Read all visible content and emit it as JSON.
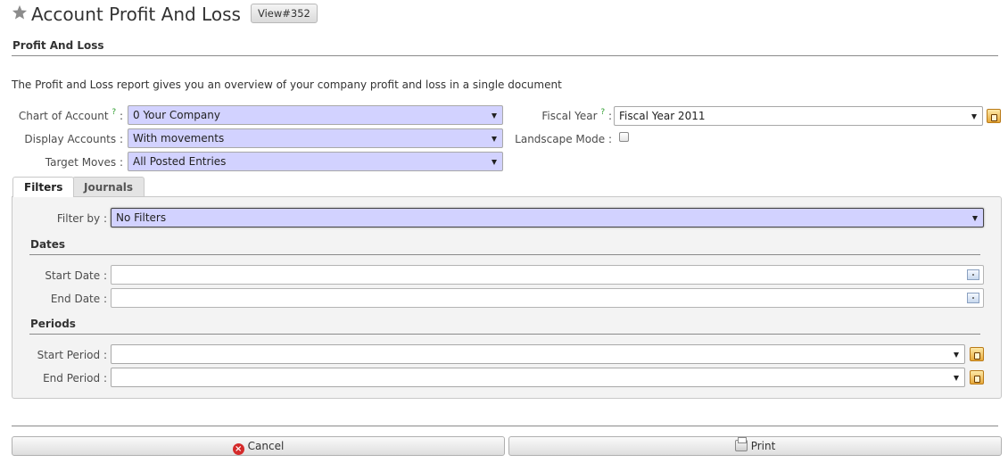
{
  "header": {
    "title": "Account Profit And Loss",
    "view_button": "View#352"
  },
  "section": {
    "title": "Profit And Loss",
    "description": "The Profit and Loss report gives you an overview of your company profit and loss in a single document"
  },
  "form": {
    "chart_of_account": {
      "label": "Chart of Account",
      "help": "?",
      "value": "0 Your Company"
    },
    "fiscal_year": {
      "label": "Fiscal Year",
      "help": "?",
      "value": "Fiscal Year 2011"
    },
    "display_accounts": {
      "label": "Display Accounts",
      "value": "With movements"
    },
    "landscape_mode": {
      "label": "Landscape Mode",
      "checked": false
    },
    "target_moves": {
      "label": "Target Moves",
      "value": "All Posted Entries"
    }
  },
  "tabs": [
    {
      "label": "Filters",
      "active": true
    },
    {
      "label": "Journals",
      "active": false
    }
  ],
  "filters": {
    "filter_by": {
      "label": "Filter by",
      "value": "No Filters"
    },
    "dates_title": "Dates",
    "start_date": {
      "label": "Start Date",
      "value": ""
    },
    "end_date": {
      "label": "End Date",
      "value": ""
    },
    "periods_title": "Periods",
    "start_period": {
      "label": "Start Period",
      "value": ""
    },
    "end_period": {
      "label": "End Period",
      "value": ""
    }
  },
  "buttons": {
    "cancel": "Cancel",
    "print": "Print"
  },
  "colors": {
    "required_field_bg": "#d2d2ff",
    "help_mark": "#2c9c2c",
    "cancel_icon": "#d42a2a"
  }
}
